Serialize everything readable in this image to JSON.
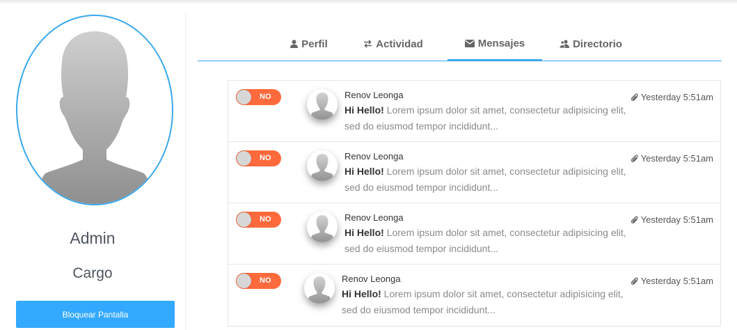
{
  "profile": {
    "name": "Admin",
    "role": "Cargo",
    "lock_button": "Bloquear Pantalla",
    "accent_color": "#3aa8ec",
    "avatar_icon": "user-silhouette-icon"
  },
  "tabs": [
    {
      "label": "Perfil",
      "icon": "user-icon",
      "active": false
    },
    {
      "label": "Actividad",
      "icon": "exchange-icon",
      "active": false
    },
    {
      "label": "Mensajes",
      "icon": "envelope-icon",
      "active": true
    },
    {
      "label": "Directorio",
      "icon": "users-icon",
      "active": false
    }
  ],
  "messages": [
    {
      "toggle": "NO",
      "sender": "Renov Leonga",
      "greeting": "Hi Hello!",
      "text": "Lorem ipsum dolor sit amet, consectetur adipisicing elit, sed do eiusmod tempor incididunt...",
      "time": "Yesterday 5:51am"
    },
    {
      "toggle": "NO",
      "sender": "Renov Leonga",
      "greeting": "Hi Hello!",
      "text": "Lorem ipsum dolor sit amet, consectetur adipisicing elit, sed do eiusmod tempor incididunt...",
      "time": "Yesterday 5:51am"
    },
    {
      "toggle": "NO",
      "sender": "Renov Leonga",
      "greeting": "Hi Hello!",
      "text": "Lorem ipsum dolor sit amet, consectetur adipisicing elit, sed do eiusmod tempor incididunt...",
      "time": "Yesterday 5:51am"
    },
    {
      "toggle": "NO",
      "sender": "Renov Leonga",
      "greeting": "Hi Hello!",
      "text": "Lorem ipsum dolor sit amet, consectetur adipisicing elit, sed do eiusmod tempor incididunt...",
      "time": "Yesterday 5:51am"
    }
  ],
  "colors": {
    "toggle_off": "#ff6a3d",
    "button": "#33a9ff"
  }
}
